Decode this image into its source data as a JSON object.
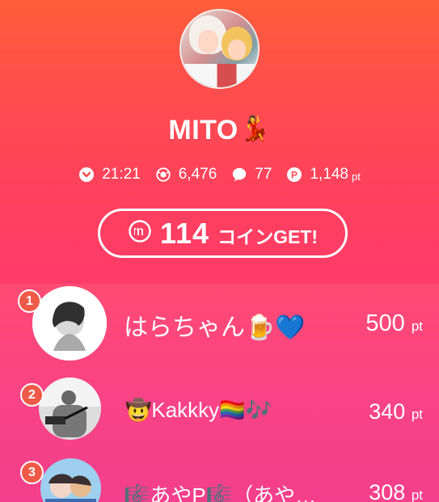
{
  "profile": {
    "name": "MITO",
    "name_emoji": "💃"
  },
  "stats": [
    {
      "icon": "clock-icon",
      "value": "21:21"
    },
    {
      "icon": "audience-icon",
      "value": "6,476"
    },
    {
      "icon": "comment-icon",
      "value": "77"
    },
    {
      "icon": "points-icon",
      "value": "1,148",
      "unit": "pt"
    }
  ],
  "coin_banner": {
    "icon": "m-coin-icon",
    "amount": "114",
    "label": "コインGET!"
  },
  "ranking": [
    {
      "rank": "1",
      "name": "はらちゃん🍺💙",
      "points": "500",
      "unit": "pt"
    },
    {
      "rank": "2",
      "name": "🤠Kakkky🏳️‍🌈🎶",
      "points": "340",
      "unit": "pt"
    },
    {
      "rank": "3",
      "name": "🎼あやP🎼（あや…",
      "points": "308",
      "unit": "pt"
    }
  ],
  "colors": {
    "background_top": "#ff5d3a",
    "background_bottom": "#f22f83",
    "badge": "#ee5a47"
  }
}
